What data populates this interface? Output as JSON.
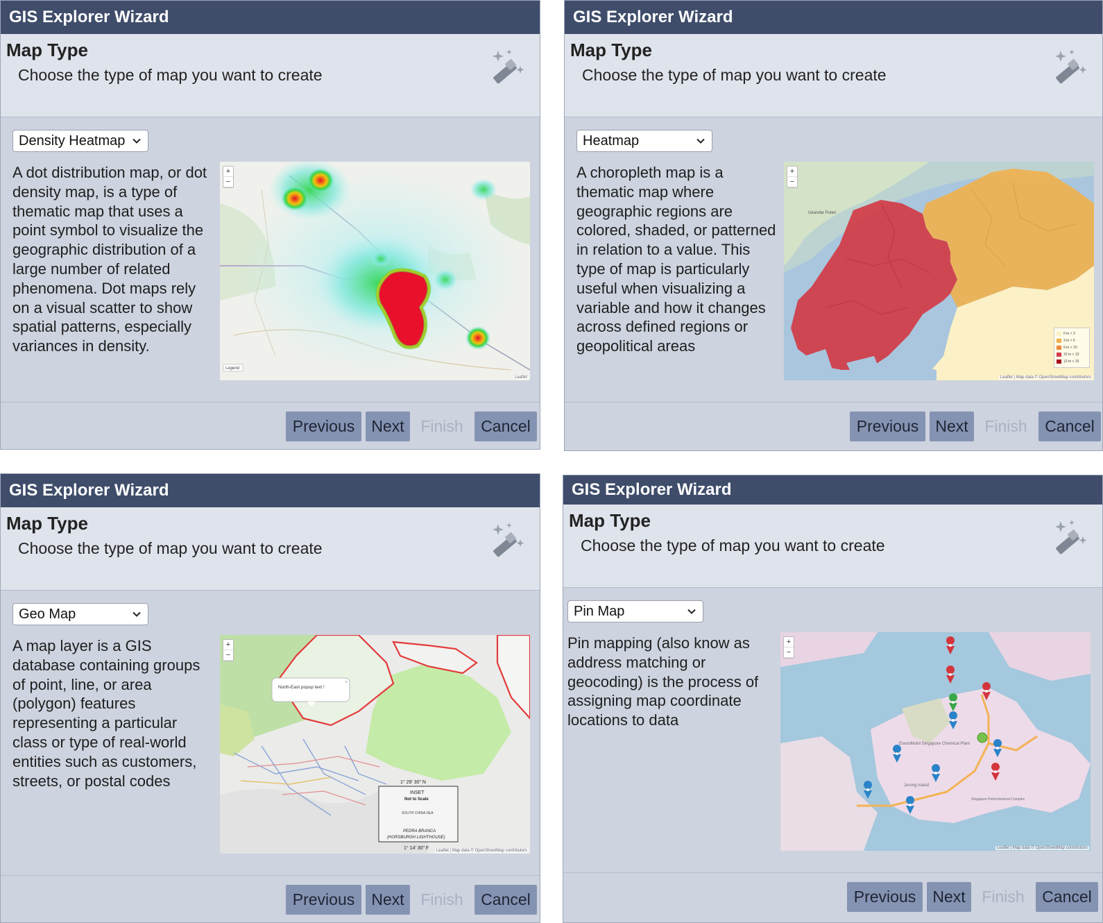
{
  "panels": [
    {
      "window_title": "GIS Explorer Wizard",
      "header_title": "Map Type",
      "header_subtitle": "Choose the type of map you want to create",
      "selected_map_type": "Density Heatmap",
      "description": "A dot distribution map, or dot density map, is a type of thematic map that uses a point symbol to visualize the geographic distribution of a large number of related phenomena. Dot maps rely on a visual scatter to show spatial patterns, especially variances in density.",
      "map_legend_label": "Legend",
      "map_attribution": "Leaflet",
      "buttons": {
        "previous": "Previous",
        "next": "Next",
        "finish": "Finish",
        "cancel": "Cancel"
      }
    },
    {
      "window_title": "GIS Explorer Wizard",
      "header_title": "Map Type",
      "header_subtitle": "Choose the type of map you want to create",
      "selected_map_type": "Heatmap",
      "description": "A choropleth map is a thematic map where geographic regions are colored, shaded, or patterned in relation to a value. This type of map is particularly useful when visualizing a variable and how it changes across defined regions or geopolitical areas",
      "map_legend": [
        "0 to < 3",
        "3 to < 6",
        "6 to < 10",
        "10 to < 13",
        "13 to < 16"
      ],
      "map_place_label": "Iskandar Puteri",
      "map_attribution": "Leaflet | Map data © OpenStreetMap contributors",
      "buttons": {
        "previous": "Previous",
        "next": "Next",
        "finish": "Finish",
        "cancel": "Cancel"
      }
    },
    {
      "window_title": "GIS Explorer Wizard",
      "header_title": "Map Type",
      "header_subtitle": "Choose the type of map you want to create",
      "selected_map_type": "Geo Map",
      "description": "A map layer is a GIS database containing groups of point, line, or area (polygon) features representing a particular class or type of real-world entities such as customers, streets, or postal codes",
      "map_popup_text": "North-East popup text !",
      "map_inset": {
        "coord_top": "1° 29' 30\" N",
        "coord_bottom": "1° 14' 30\" F",
        "title": "INSET",
        "subtitle": "Not to Scale",
        "sea": "SOUTH CHINA SEA",
        "place": "PEDRA BRANCA",
        "place_sub": "(HORSBURGH LIGHTHOUSE)"
      },
      "map_attribution": "Leaflet | Map data © OpenStreetMap contributors",
      "buttons": {
        "previous": "Previous",
        "next": "Next",
        "finish": "Finish",
        "cancel": "Cancel"
      }
    },
    {
      "window_title": "GIS Explorer Wizard",
      "header_title": "Map Type",
      "header_subtitle": "Choose the type of map you want to create",
      "selected_map_type": "Pin Map",
      "description": "Pin mapping (also know as address matching or geocoding) is the process of assigning map coordinate locations to data",
      "map_labels": [
        "ExxonMobil Singapore Chemical Plant",
        "Jurong Island",
        "Singapore Petrochemical Complex"
      ],
      "map_attribution": "Leaflet | Map data © OpenStreetMap contributors",
      "buttons": {
        "previous": "Previous",
        "next": "Next",
        "finish": "Finish",
        "cancel": "Cancel"
      }
    }
  ],
  "colors": {
    "titlebar": "#3f4d6b",
    "header": "#dfe3ec",
    "panel": "#cdd3df",
    "button": "#8593b3",
    "button_disabled_text": "#aab1c2"
  }
}
